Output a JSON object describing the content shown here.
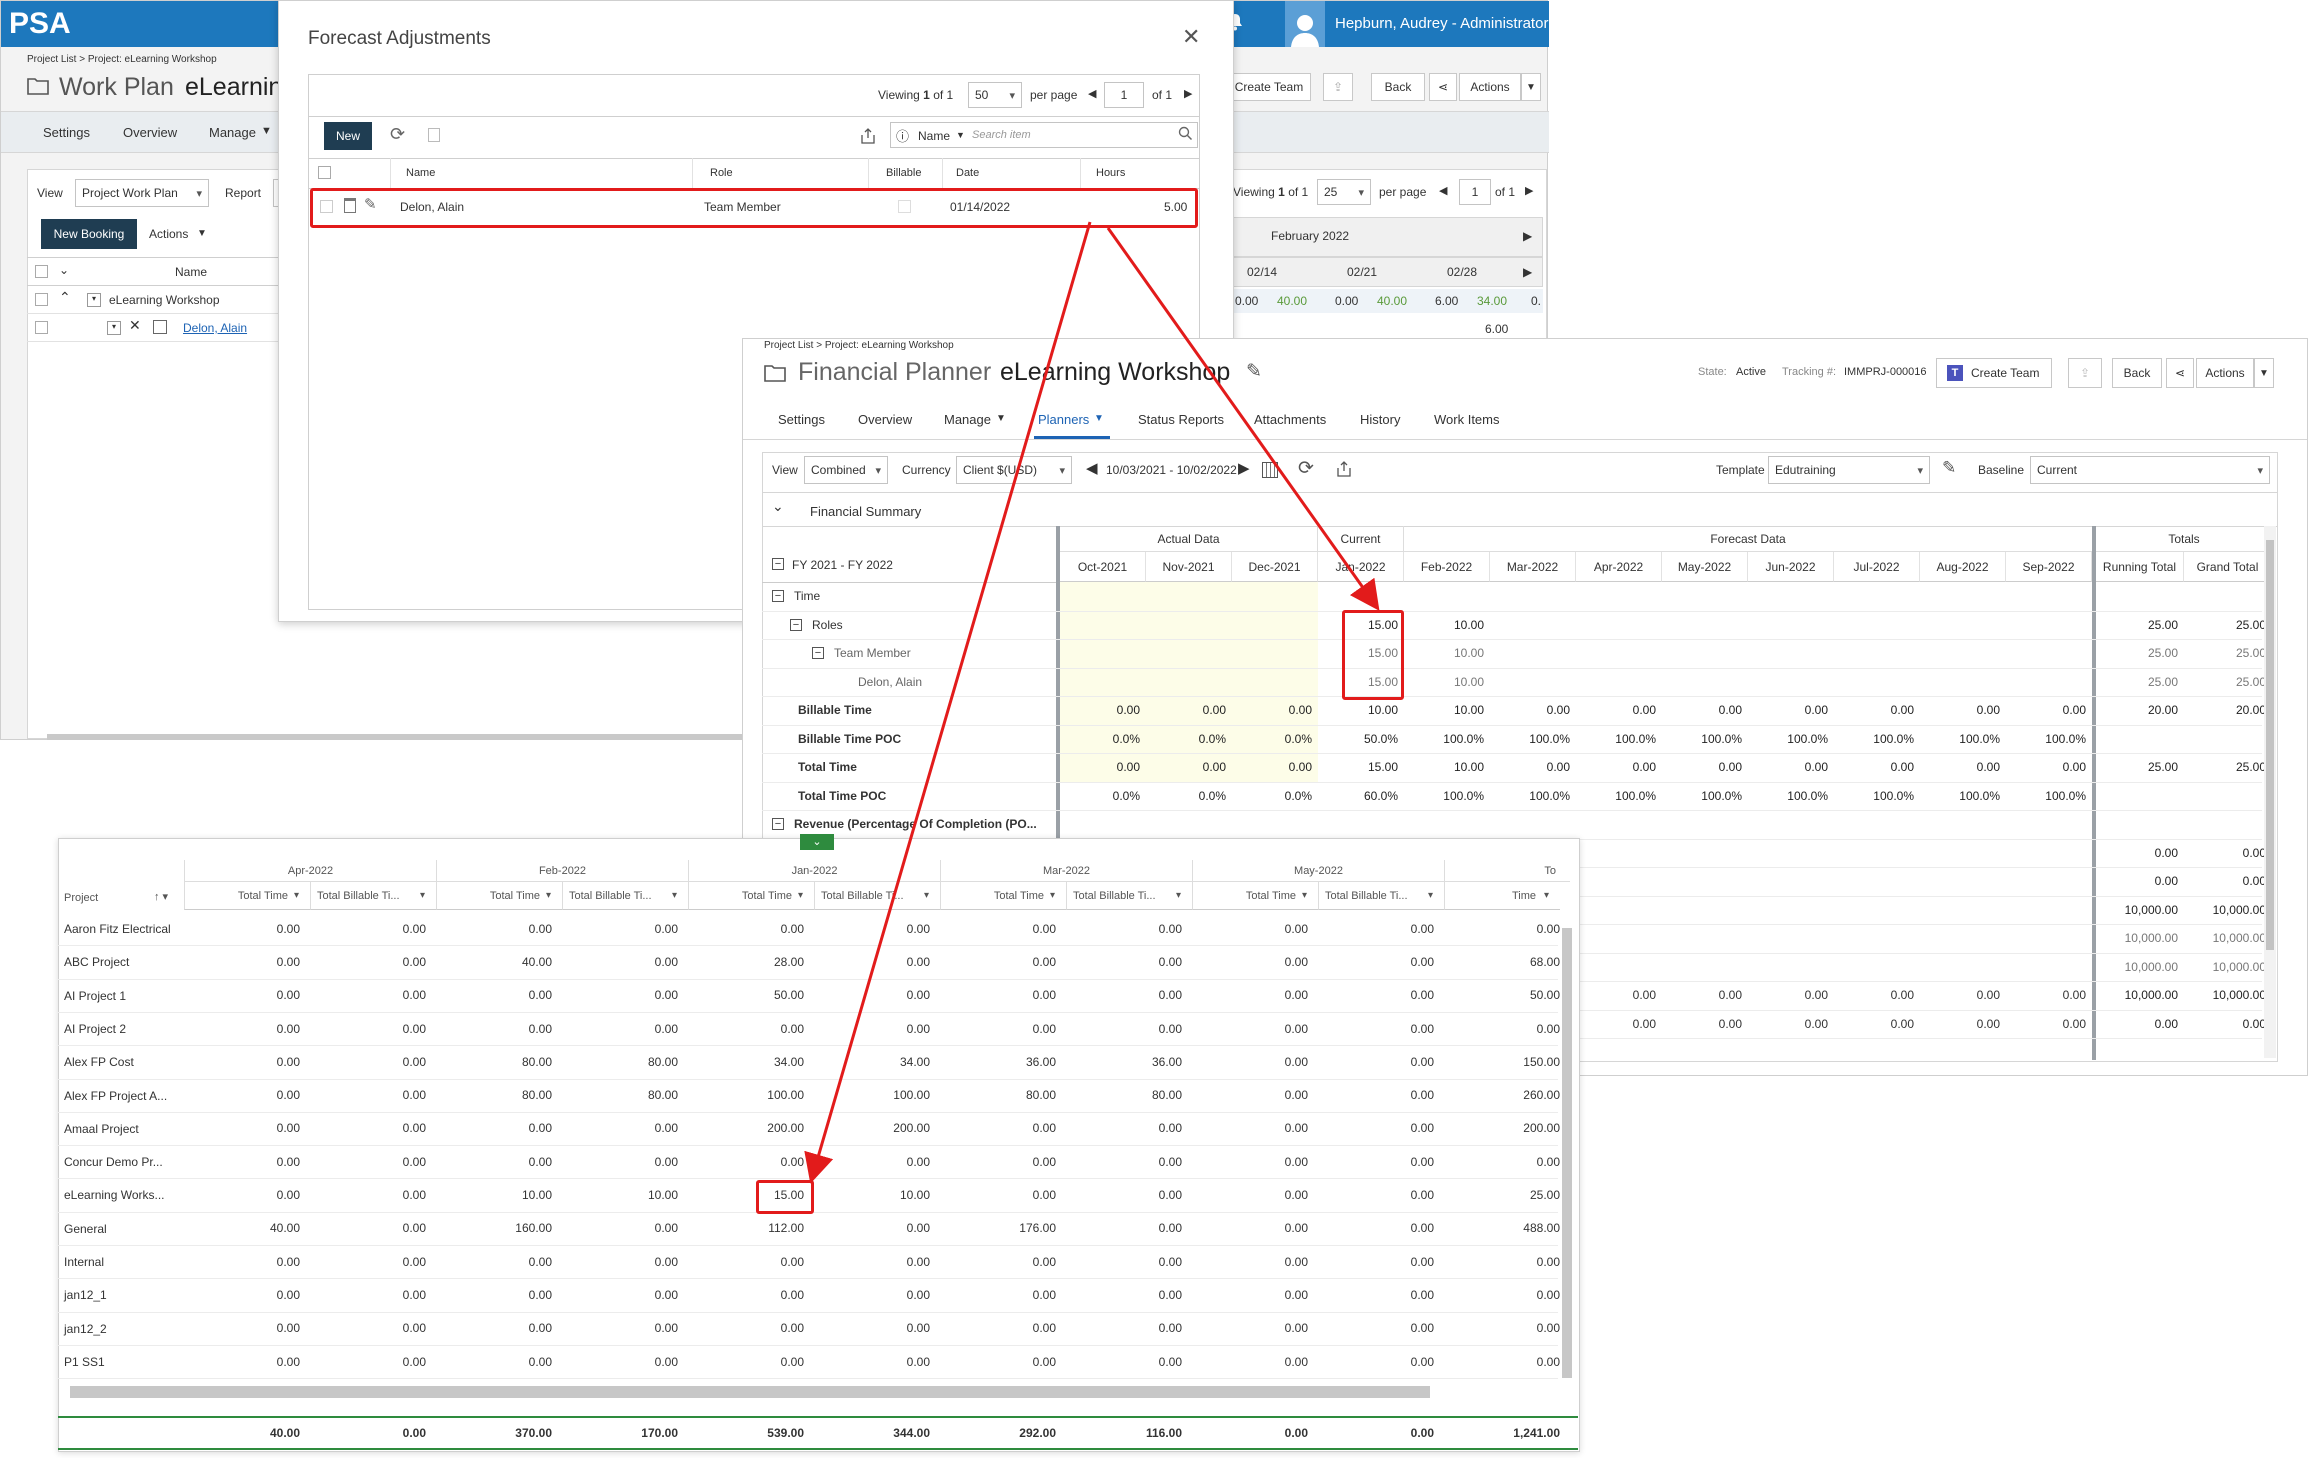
{
  "work_plan": {
    "logo": "PSA",
    "user": "Hepburn, Audrey - Administrator",
    "breadcrumb": "Project List > Project: eLearning Workshop",
    "title_prefix": "Work Plan",
    "title_project": "eLearnin",
    "nav": [
      "Settings",
      "Overview",
      "Manage"
    ],
    "view_label": "View",
    "view_value": "Project Work Plan",
    "report_label": "Report",
    "new_booking": "New Booking",
    "actions": "Actions",
    "col_name": "Name",
    "rows": [
      "eLearning Workshop",
      "Delon, Alain"
    ],
    "create_team": "Create Team",
    "back": "Back",
    "actions2": "Actions",
    "viewing_label": "Viewing",
    "viewing_page": "1",
    "viewing_of": "of 1",
    "per_page_value": "25",
    "per_page_label": "per page",
    "page_input": "1",
    "page_of": "of 1",
    "month": "February 2022",
    "weeks": [
      "02/14",
      "02/21",
      "02/28"
    ],
    "week_values": [
      "0.00",
      "40.00",
      "0.00",
      "40.00",
      "6.00",
      "34.00",
      "0."
    ],
    "sub_value": "6.00"
  },
  "forecast": {
    "title": "Forecast Adjustments",
    "viewing_label": "Viewing",
    "viewing_page": "1",
    "viewing_of": "of 1",
    "per_page_value": "50",
    "per_page_label": "per page",
    "page_input": "1",
    "page_of": "of 1",
    "new_button": "New",
    "search_field": "Name",
    "search_placeholder": "Search item",
    "columns": [
      "Name",
      "Role",
      "Billable",
      "Date",
      "Hours"
    ],
    "row": {
      "name": "Delon, Alain",
      "role": "Team Member",
      "date": "01/14/2022",
      "hours": "5.00"
    }
  },
  "financial": {
    "breadcrumb": "Project List > Project: eLearning Workshop",
    "title_prefix": "Financial Planner",
    "title_project": "eLearning Workshop",
    "state_label": "State:",
    "state_value": "Active",
    "tracking_label": "Tracking #:",
    "tracking_value": "IMMPRJ-000016",
    "create_team": "Create Team",
    "back": "Back",
    "actions": "Actions",
    "tabs": [
      "Settings",
      "Overview",
      "Manage",
      "Planners",
      "Status Reports",
      "Attachments",
      "History",
      "Work Items"
    ],
    "view_label": "View",
    "view_value": "Combined",
    "currency_label": "Currency",
    "currency_value": "Client $(USD)",
    "date_range": "10/03/2021 - 10/02/2022",
    "template_label": "Template",
    "template_value": "Edutraining",
    "baseline_label": "Baseline",
    "baseline_value": "Current",
    "summary_title": "Financial Summary",
    "fy_label": "FY 2021 - FY 2022",
    "group_actual": "Actual Data",
    "group_current": "Current",
    "group_forecast": "Forecast Data",
    "group_totals": "Totals",
    "months": [
      "Oct-2021",
      "Nov-2021",
      "Dec-2021",
      "Jan-2022",
      "Feb-2022",
      "Mar-2022",
      "Apr-2022",
      "May-2022",
      "Jun-2022",
      "Jul-2022",
      "Aug-2022",
      "Sep-2022"
    ],
    "total_cols": [
      "Running Total",
      "Grand Total"
    ],
    "rows": [
      {
        "label": "Time",
        "level": 0,
        "toggle": true,
        "bold": false,
        "values": [
          "",
          "",
          "",
          "",
          "",
          "",
          "",
          "",
          "",
          "",
          "",
          ""
        ],
        "totals": [
          "",
          ""
        ]
      },
      {
        "label": "Roles",
        "level": 1,
        "toggle": true,
        "bold": false,
        "values": [
          "",
          "",
          "",
          "15.00",
          "10.00",
          "",
          "",
          "",
          "",
          "",
          "",
          ""
        ],
        "totals": [
          "25.00",
          "25.00"
        ]
      },
      {
        "label": "Team Member",
        "level": 2,
        "toggle": true,
        "bold": false,
        "values": [
          "",
          "",
          "",
          "15.00",
          "10.00",
          "",
          "",
          "",
          "",
          "",
          "",
          ""
        ],
        "totals": [
          "25.00",
          "25.00"
        ]
      },
      {
        "label": "Delon, Alain",
        "level": 3,
        "toggle": false,
        "bold": false,
        "values": [
          "",
          "",
          "",
          "15.00",
          "10.00",
          "",
          "",
          "",
          "",
          "",
          "",
          ""
        ],
        "totals": [
          "25.00",
          "25.00"
        ]
      },
      {
        "label": "Billable Time",
        "level": 1,
        "toggle": false,
        "bold": true,
        "values": [
          "0.00",
          "0.00",
          "0.00",
          "10.00",
          "10.00",
          "0.00",
          "0.00",
          "0.00",
          "0.00",
          "0.00",
          "0.00",
          "0.00"
        ],
        "totals": [
          "20.00",
          "20.00"
        ]
      },
      {
        "label": "Billable Time POC",
        "level": 1,
        "toggle": false,
        "bold": true,
        "values": [
          "0.0%",
          "0.0%",
          "0.0%",
          "50.0%",
          "100.0%",
          "100.0%",
          "100.0%",
          "100.0%",
          "100.0%",
          "100.0%",
          "100.0%",
          "100.0%"
        ],
        "totals": [
          "",
          ""
        ]
      },
      {
        "label": "Total Time",
        "level": 1,
        "toggle": false,
        "bold": true,
        "values": [
          "0.00",
          "0.00",
          "0.00",
          "15.00",
          "10.00",
          "0.00",
          "0.00",
          "0.00",
          "0.00",
          "0.00",
          "0.00",
          "0.00"
        ],
        "totals": [
          "25.00",
          "25.00"
        ]
      },
      {
        "label": "Total Time POC",
        "level": 1,
        "toggle": false,
        "bold": true,
        "values": [
          "0.0%",
          "0.0%",
          "0.0%",
          "60.0%",
          "100.0%",
          "100.0%",
          "100.0%",
          "100.0%",
          "100.0%",
          "100.0%",
          "100.0%",
          "100.0%"
        ],
        "totals": [
          "",
          ""
        ]
      },
      {
        "label": "Revenue (Percentage Of Completion (PO...",
        "level": 0,
        "toggle": true,
        "bold": true,
        "values": [
          "",
          "",
          "",
          "",
          "",
          "",
          "",
          "",
          "",
          "",
          "",
          ""
        ],
        "totals": [
          "",
          ""
        ]
      }
    ],
    "lower_totals": [
      [
        "0.00",
        "0.00"
      ],
      [
        "0.00",
        "0.00"
      ],
      [
        "10,000.00",
        "10,000.00"
      ],
      [
        "10,000.00",
        "10,000.00"
      ],
      [
        "10,000.00",
        "10,000.00"
      ],
      [
        "10,000.00",
        "10,000.00"
      ],
      [
        "0.00",
        "0.00"
      ]
    ],
    "lower_month_values": [
      [
        "",
        "",
        "",
        "",
        "",
        ""
      ],
      [
        "",
        "",
        "",
        "",
        "",
        ""
      ],
      [
        "",
        "",
        "",
        "",
        "",
        ""
      ],
      [
        "",
        "",
        "",
        "",
        "",
        ""
      ],
      [
        "",
        "",
        "",
        "",
        "",
        ""
      ],
      [
        "0.00",
        "0.00",
        "0.00",
        "0.00",
        "0.00",
        "0.00"
      ],
      [
        "0.00",
        "0.00",
        "0.00",
        "0.00",
        "0.00",
        "0.00"
      ]
    ]
  },
  "report": {
    "month_groups": [
      "Apr-2022",
      "Feb-2022",
      "Jan-2022",
      "Mar-2022",
      "May-2022",
      "To"
    ],
    "project_col": "Project",
    "sub_cols": [
      "Total Time",
      "Total Billable Ti..."
    ],
    "last_col": "Time",
    "rows": [
      {
        "project": "Aaron Fitz Electrical",
        "values": [
          "0.00",
          "0.00",
          "0.00",
          "0.00",
          "0.00",
          "0.00",
          "0.00",
          "0.00",
          "0.00",
          "0.00",
          "0.00"
        ]
      },
      {
        "project": "ABC Project",
        "values": [
          "0.00",
          "0.00",
          "40.00",
          "0.00",
          "28.00",
          "0.00",
          "0.00",
          "0.00",
          "0.00",
          "0.00",
          "68.00"
        ]
      },
      {
        "project": "AI Project 1",
        "values": [
          "0.00",
          "0.00",
          "0.00",
          "0.00",
          "50.00",
          "0.00",
          "0.00",
          "0.00",
          "0.00",
          "0.00",
          "50.00"
        ]
      },
      {
        "project": "AI Project 2",
        "values": [
          "0.00",
          "0.00",
          "0.00",
          "0.00",
          "0.00",
          "0.00",
          "0.00",
          "0.00",
          "0.00",
          "0.00",
          "0.00"
        ]
      },
      {
        "project": "Alex FP Cost",
        "values": [
          "0.00",
          "0.00",
          "80.00",
          "80.00",
          "34.00",
          "34.00",
          "36.00",
          "36.00",
          "0.00",
          "0.00",
          "150.00"
        ]
      },
      {
        "project": "Alex FP Project A...",
        "values": [
          "0.00",
          "0.00",
          "80.00",
          "80.00",
          "100.00",
          "100.00",
          "80.00",
          "80.00",
          "0.00",
          "0.00",
          "260.00"
        ]
      },
      {
        "project": "Amaal Project",
        "values": [
          "0.00",
          "0.00",
          "0.00",
          "0.00",
          "200.00",
          "200.00",
          "0.00",
          "0.00",
          "0.00",
          "0.00",
          "200.00"
        ]
      },
      {
        "project": "Concur Demo Pr...",
        "values": [
          "0.00",
          "0.00",
          "0.00",
          "0.00",
          "0.00",
          "0.00",
          "0.00",
          "0.00",
          "0.00",
          "0.00",
          "0.00"
        ]
      },
      {
        "project": "eLearning Works...",
        "values": [
          "0.00",
          "0.00",
          "10.00",
          "10.00",
          "15.00",
          "10.00",
          "0.00",
          "0.00",
          "0.00",
          "0.00",
          "25.00"
        ]
      },
      {
        "project": "General",
        "values": [
          "40.00",
          "0.00",
          "160.00",
          "0.00",
          "112.00",
          "0.00",
          "176.00",
          "0.00",
          "0.00",
          "0.00",
          "488.00"
        ]
      },
      {
        "project": "Internal",
        "values": [
          "0.00",
          "0.00",
          "0.00",
          "0.00",
          "0.00",
          "0.00",
          "0.00",
          "0.00",
          "0.00",
          "0.00",
          "0.00"
        ]
      },
      {
        "project": "jan12_1",
        "values": [
          "0.00",
          "0.00",
          "0.00",
          "0.00",
          "0.00",
          "0.00",
          "0.00",
          "0.00",
          "0.00",
          "0.00",
          "0.00"
        ]
      },
      {
        "project": "jan12_2",
        "values": [
          "0.00",
          "0.00",
          "0.00",
          "0.00",
          "0.00",
          "0.00",
          "0.00",
          "0.00",
          "0.00",
          "0.00",
          "0.00"
        ]
      },
      {
        "project": "P1 SS1",
        "values": [
          "0.00",
          "0.00",
          "0.00",
          "0.00",
          "0.00",
          "0.00",
          "0.00",
          "0.00",
          "0.00",
          "0.00",
          "0.00"
        ]
      }
    ],
    "footer": [
      "40.00",
      "0.00",
      "370.00",
      "170.00",
      "539.00",
      "344.00",
      "292.00",
      "116.00",
      "0.00",
      "0.00",
      "1,241.00"
    ]
  },
  "colors": {
    "header_blue": "#1d78bd",
    "dark_button": "#1f3d52",
    "highlight_red": "#e21b1b",
    "actual_bg": "#fdfde8",
    "forecast_green": "#5a9a3a"
  }
}
